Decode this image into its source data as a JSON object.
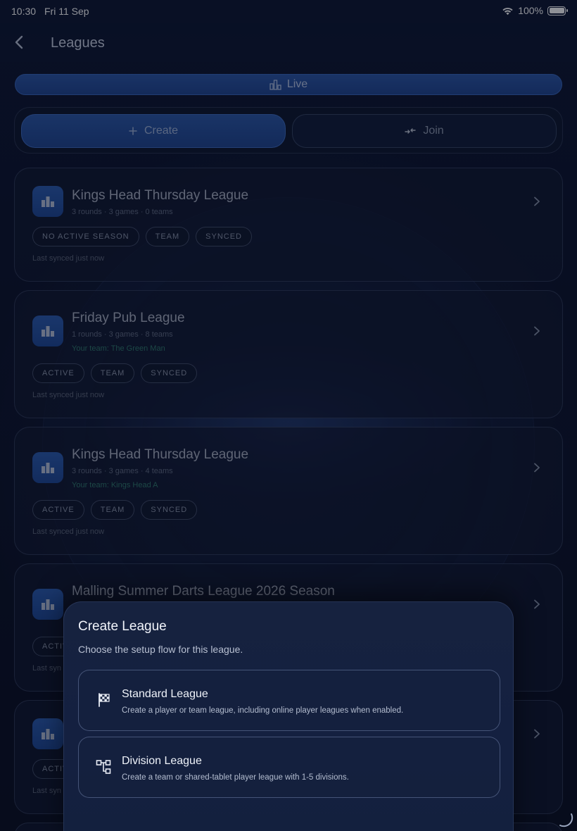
{
  "status_bar": {
    "time": "10:30",
    "date": "Fri 11 Sep",
    "battery": "100%"
  },
  "header": {
    "title": "Leagues"
  },
  "live_button": {
    "label": "Live"
  },
  "actions": {
    "create_label": "Create",
    "join_label": "Join"
  },
  "leagues": [
    {
      "name": "Kings Head Thursday League",
      "meta": "3 rounds · 3 games · 0 teams",
      "team": "",
      "chips": [
        "NO ACTIVE SEASON",
        "TEAM",
        "SYNCED"
      ],
      "synced": "Last synced just now"
    },
    {
      "name": "Friday Pub League",
      "meta": "1 rounds · 3 games · 8 teams",
      "team": "Your team: The Green Man",
      "chips": [
        "ACTIVE",
        "TEAM",
        "SYNCED"
      ],
      "synced": "Last synced just now"
    },
    {
      "name": "Kings Head Thursday League",
      "meta": "3 rounds · 3 games · 4 teams",
      "team": "Your team: Kings Head A",
      "chips": [
        "ACTIVE",
        "TEAM",
        "SYNCED"
      ],
      "synced": "Last synced just now"
    },
    {
      "name": "Malling Summer Darts League 2026 Season",
      "chip_partial": "ACTIV",
      "synced_partial": "Last syn"
    },
    {
      "chip_partial": "ACTIV",
      "synced_partial": "Last syn"
    }
  ],
  "sheet": {
    "title": "Create League",
    "subtitle": "Choose the setup flow for this league.",
    "options": [
      {
        "title": "Standard League",
        "description": "Create a player or team league, including online player leagues when enabled.",
        "icon": "checkered-flag-icon"
      },
      {
        "title": "Division League",
        "description": "Create a team or shared-tablet player league with 1-5 divisions.",
        "icon": "division-tree-icon"
      }
    ]
  },
  "colors": {
    "accent": "#2a57a8",
    "team_text": "#2f7a6c",
    "background": "#0a1024"
  }
}
